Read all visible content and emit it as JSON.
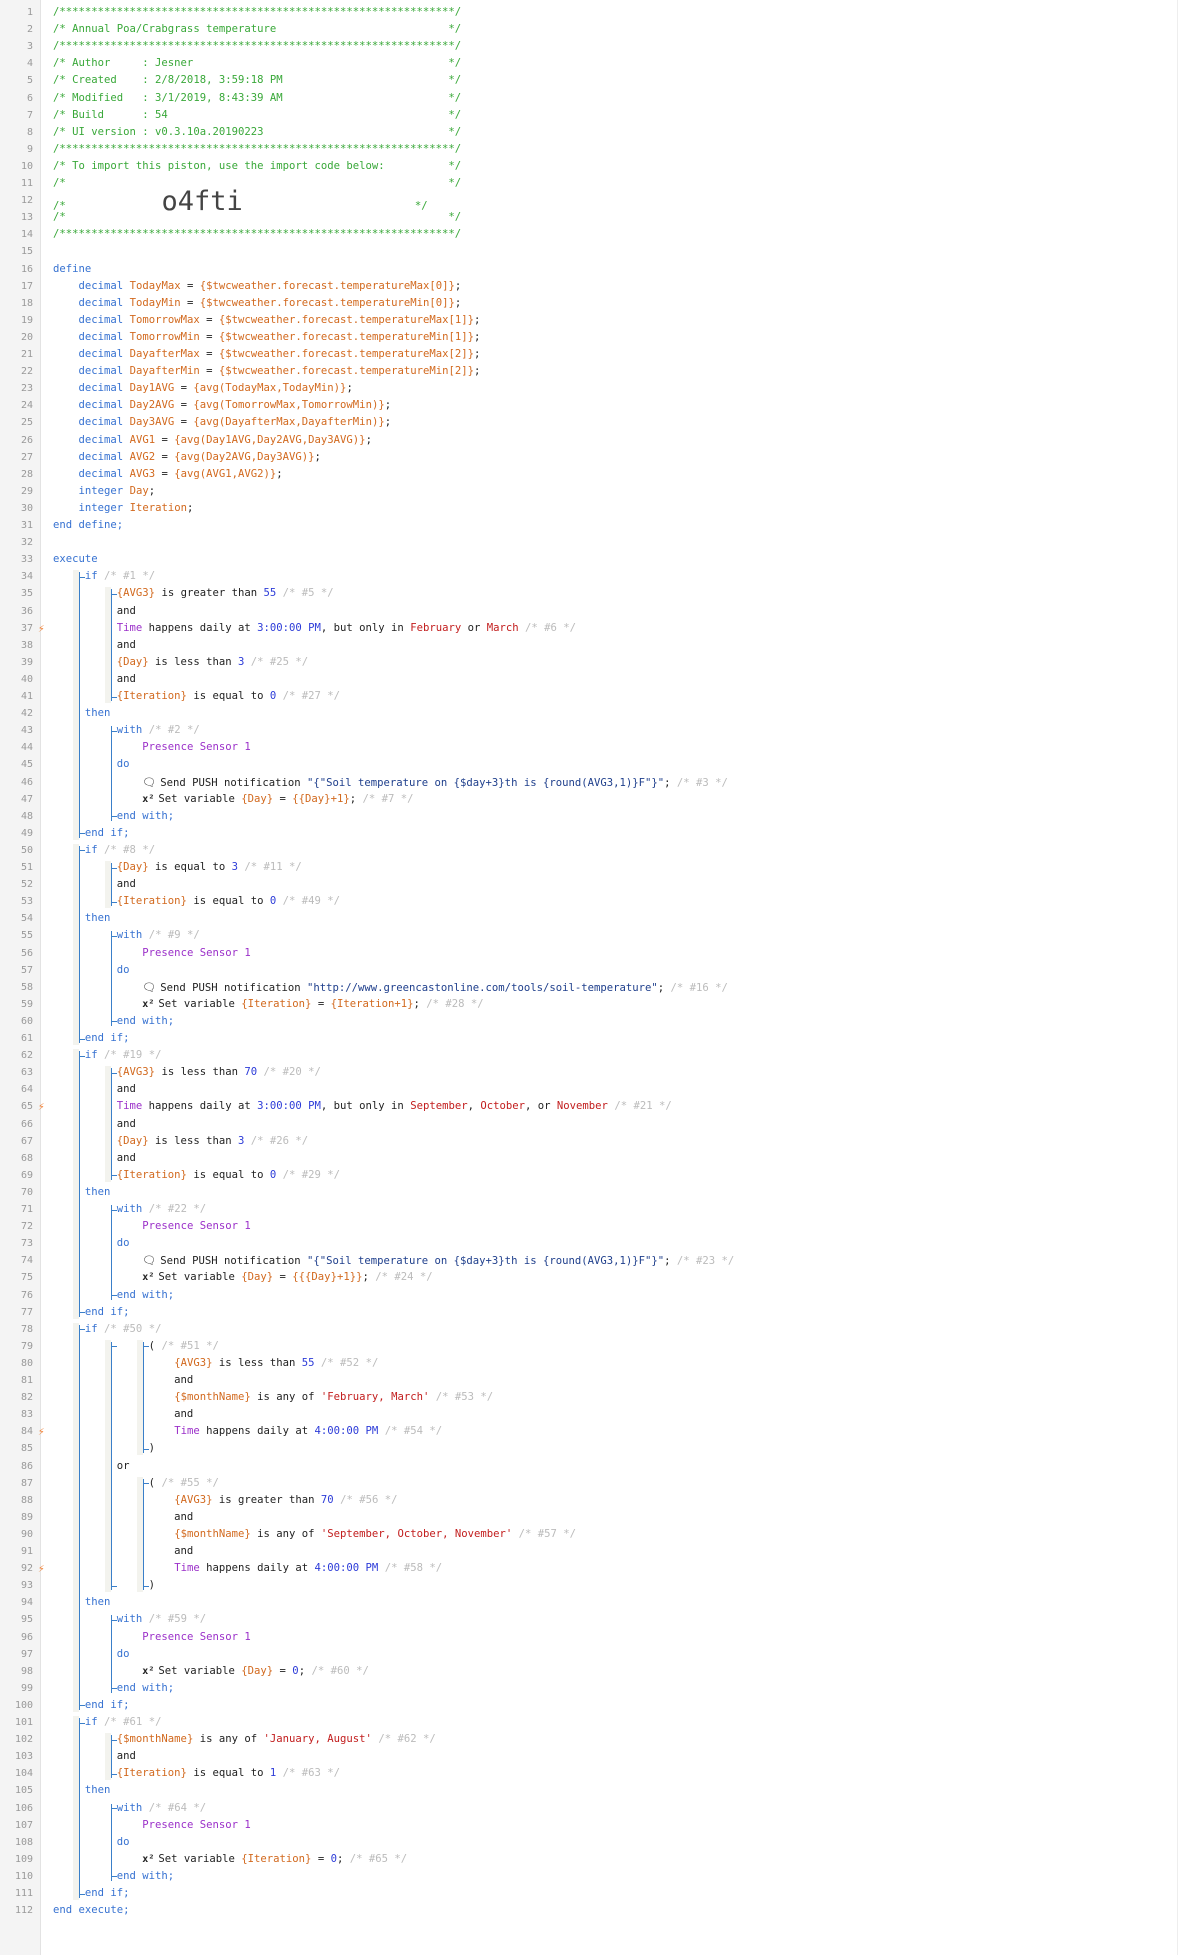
{
  "lines": [
    {
      "n": "1",
      "html": "<span class='c'>/**************************************************************/</span>"
    },
    {
      "n": "2",
      "html": "<span class='c'>/* Annual Poa/Crabgrass temperature                           */</span>"
    },
    {
      "n": "3",
      "html": "<span class='c'>/**************************************************************/</span>"
    },
    {
      "n": "4",
      "html": "<span class='c'>/* Author     : Jesner                                        */</span>"
    },
    {
      "n": "5",
      "html": "<span class='c'>/* Created    : 2/8/2018, 3:59:18 PM                          */</span>"
    },
    {
      "n": "6",
      "html": "<span class='c'>/* Modified   : 3/1/2019, 8:43:39 AM                          */</span>"
    },
    {
      "n": "7",
      "html": "<span class='c'>/* Build      : 54                                            */</span>"
    },
    {
      "n": "8",
      "html": "<span class='c'>/* UI version : v0.3.10a.20190223                             */</span>"
    },
    {
      "n": "9",
      "html": "<span class='c'>/**************************************************************/</span>"
    },
    {
      "n": "10",
      "html": "<span class='c'>/* To import this piston, use the import code below:          */</span>"
    },
    {
      "n": "11",
      "html": "<span class='c'>/*                                                            */</span>"
    },
    {
      "n": "12",
      "html": "<span class='c'>/*               <span class='big'>o4fti</span>                           */</span>"
    },
    {
      "n": "13",
      "html": "<span class='c'>/*                                                            */</span>"
    },
    {
      "n": "14",
      "html": "<span class='c'>/**************************************************************/</span>"
    },
    {
      "n": "15",
      "html": ""
    },
    {
      "n": "16",
      "html": "<span class='kw'>define</span>"
    },
    {
      "n": "17",
      "html": "    <span class='kw'>decimal</span> <span class='var'>TodayMax</span> = <span class='var'>{$twcweather.forecast.temperatureMax[0]}</span>;"
    },
    {
      "n": "18",
      "html": "    <span class='kw'>decimal</span> <span class='var'>TodayMin</span> = <span class='var'>{$twcweather.forecast.temperatureMin[0]}</span>;"
    },
    {
      "n": "19",
      "html": "    <span class='kw'>decimal</span> <span class='var'>TomorrowMax</span> = <span class='var'>{$twcweather.forecast.temperatureMax[1]}</span>;"
    },
    {
      "n": "20",
      "html": "    <span class='kw'>decimal</span> <span class='var'>TomorrowMin</span> = <span class='var'>{$twcweather.forecast.temperatureMin[1]}</span>;"
    },
    {
      "n": "21",
      "html": "    <span class='kw'>decimal</span> <span class='var'>DayafterMax</span> = <span class='var'>{$twcweather.forecast.temperatureMax[2]}</span>;"
    },
    {
      "n": "22",
      "html": "    <span class='kw'>decimal</span> <span class='var'>DayafterMin</span> = <span class='var'>{$twcweather.forecast.temperatureMin[2]}</span>;"
    },
    {
      "n": "23",
      "html": "    <span class='kw'>decimal</span> <span class='var'>Day1AVG</span> = <span class='var'>{avg(TodayMax,TodayMin)}</span>;"
    },
    {
      "n": "24",
      "html": "    <span class='kw'>decimal</span> <span class='var'>Day2AVG</span> = <span class='var'>{avg(TomorrowMax,TomorrowMin)}</span>;"
    },
    {
      "n": "25",
      "html": "    <span class='kw'>decimal</span> <span class='var'>Day3AVG</span> = <span class='var'>{avg(DayafterMax,DayafterMin)}</span>;"
    },
    {
      "n": "26",
      "html": "    <span class='kw'>decimal</span> <span class='var'>AVG1</span> = <span class='var'>{avg(Day1AVG,Day2AVG,Day3AVG)}</span>;"
    },
    {
      "n": "27",
      "html": "    <span class='kw'>decimal</span> <span class='var'>AVG2</span> = <span class='var'>{avg(Day2AVG,Day3AVG)}</span>;"
    },
    {
      "n": "28",
      "html": "    <span class='kw'>decimal</span> <span class='var'>AVG3</span> = <span class='var'>{avg(AVG1,AVG2)}</span>;"
    },
    {
      "n": "29",
      "html": "    <span class='kw'>integer</span> <span class='var'>Day</span>;"
    },
    {
      "n": "30",
      "html": "    <span class='kw'>integer</span> <span class='var'>Iteration</span>;"
    },
    {
      "n": "31",
      "html": "<span class='kw'>end define;</span>"
    },
    {
      "n": "32",
      "html": ""
    },
    {
      "n": "33",
      "html": "<span class='kw'>execute</span>"
    },
    {
      "n": "34",
      "html": "     <span class='kw'>if</span> <span class='cmt'>/* #1 */</span>"
    },
    {
      "n": "35",
      "html": "          <span class='var'>{AVG3}</span> is greater than <span class='num'>55</span> <span class='cmt'>/* #5 */</span>"
    },
    {
      "n": "36",
      "html": "          and"
    },
    {
      "n": "37",
      "bolt": true,
      "html": "          <span class='tk'>Time</span> happens daily at <span class='tm'>3:00:00 PM</span>, but only in <span class='mon'>February</span> or <span class='mon'>March</span> <span class='cmt'>/* #6 */</span>"
    },
    {
      "n": "38",
      "html": "          and"
    },
    {
      "n": "39",
      "html": "          <span class='var'>{Day}</span> is less than <span class='num'>3</span> <span class='cmt'>/* #25 */</span>"
    },
    {
      "n": "40",
      "html": "          and"
    },
    {
      "n": "41",
      "html": "          <span class='var'>{Iteration}</span> is equal to <span class='num'>0</span> <span class='cmt'>/* #27 */</span>"
    },
    {
      "n": "42",
      "html": "     <span class='kw'>then</span>"
    },
    {
      "n": "43",
      "html": "          <span class='kw'>with</span> <span class='cmt'>/* #2 */</span>"
    },
    {
      "n": "44",
      "html": "              <span class='dev'>Presence Sensor 1</span>"
    },
    {
      "n": "45",
      "html": "          <span class='kw'>do</span>"
    },
    {
      "n": "46",
      "html": "              <span class='icon'>&#x1F5E8;</span>Send PUSH notification <span class='strv'>\"{\"Soil temperature on {$day+3}th is {round(AVG3,1)}F\"}\"</span>; <span class='cmt'>/* #3 */</span>"
    },
    {
      "n": "47",
      "html": "              <span class='x2'>x&#178;</span>Set variable <span class='var'>{Day}</span> = <span class='var'>{{Day}+1}</span>; <span class='cmt'>/* #7 */</span>"
    },
    {
      "n": "48",
      "html": "          <span class='kw'>end with;</span>"
    },
    {
      "n": "49",
      "html": "     <span class='kw'>end if;</span>"
    },
    {
      "n": "50",
      "html": "     <span class='kw'>if</span> <span class='cmt'>/* #8 */</span>"
    },
    {
      "n": "51",
      "html": "          <span class='var'>{Day}</span> is equal to <span class='num'>3</span> <span class='cmt'>/* #11 */</span>"
    },
    {
      "n": "52",
      "html": "          and"
    },
    {
      "n": "53",
      "html": "          <span class='var'>{Iteration}</span> is equal to <span class='num'>0</span> <span class='cmt'>/* #49 */</span>"
    },
    {
      "n": "54",
      "html": "     <span class='kw'>then</span>"
    },
    {
      "n": "55",
      "html": "          <span class='kw'>with</span> <span class='cmt'>/* #9 */</span>"
    },
    {
      "n": "56",
      "html": "              <span class='dev'>Presence Sensor 1</span>"
    },
    {
      "n": "57",
      "html": "          <span class='kw'>do</span>"
    },
    {
      "n": "58",
      "html": "              <span class='icon'>&#x1F5E8;</span>Send PUSH notification <span class='strv'>\"http://www.greencastonline.com/tools/soil-temperature\"</span>; <span class='cmt'>/* #16 */</span>"
    },
    {
      "n": "59",
      "html": "              <span class='x2'>x&#178;</span>Set variable <span class='var'>{Iteration}</span> = <span class='var'>{Iteration+1}</span>; <span class='cmt'>/* #28 */</span>"
    },
    {
      "n": "60",
      "html": "          <span class='kw'>end with;</span>"
    },
    {
      "n": "61",
      "html": "     <span class='kw'>end if;</span>"
    },
    {
      "n": "62",
      "html": "     <span class='kw'>if</span> <span class='cmt'>/* #19 */</span>"
    },
    {
      "n": "63",
      "html": "          <span class='var'>{AVG3}</span> is less than <span class='num'>70</span> <span class='cmt'>/* #20 */</span>"
    },
    {
      "n": "64",
      "html": "          and"
    },
    {
      "n": "65",
      "bolt": true,
      "html": "          <span class='tk'>Time</span> happens daily at <span class='tm'>3:00:00 PM</span>, but only in <span class='mon'>September</span>, <span class='mon'>October</span>, or <span class='mon'>November</span> <span class='cmt'>/* #21 */</span>"
    },
    {
      "n": "66",
      "html": "          and"
    },
    {
      "n": "67",
      "html": "          <span class='var'>{Day}</span> is less than <span class='num'>3</span> <span class='cmt'>/* #26 */</span>"
    },
    {
      "n": "68",
      "html": "          and"
    },
    {
      "n": "69",
      "html": "          <span class='var'>{Iteration}</span> is equal to <span class='num'>0</span> <span class='cmt'>/* #29 */</span>"
    },
    {
      "n": "70",
      "html": "     <span class='kw'>then</span>"
    },
    {
      "n": "71",
      "html": "          <span class='kw'>with</span> <span class='cmt'>/* #22 */</span>"
    },
    {
      "n": "72",
      "html": "              <span class='dev'>Presence Sensor 1</span>"
    },
    {
      "n": "73",
      "html": "          <span class='kw'>do</span>"
    },
    {
      "n": "74",
      "html": "              <span class='icon'>&#x1F5E8;</span>Send PUSH notification <span class='strv'>\"{\"Soil temperature on {$day+3}th is {round(AVG3,1)}F\"}\"</span>; <span class='cmt'>/* #23 */</span>"
    },
    {
      "n": "75",
      "html": "              <span class='x2'>x&#178;</span>Set variable <span class='var'>{Day}</span> = <span class='var'>{{{Day}+1}}</span>; <span class='cmt'>/* #24 */</span>"
    },
    {
      "n": "76",
      "html": "          <span class='kw'>end with;</span>"
    },
    {
      "n": "77",
      "html": "     <span class='kw'>end if;</span>"
    },
    {
      "n": "78",
      "html": "     <span class='kw'>if</span> <span class='cmt'>/* #50 */</span>"
    },
    {
      "n": "79",
      "html": "               ( <span class='cmt'>/* #51 */</span>"
    },
    {
      "n": "80",
      "html": "                   <span class='var'>{AVG3}</span> is less than <span class='num'>55</span> <span class='cmt'>/* #52 */</span>"
    },
    {
      "n": "81",
      "html": "                   and"
    },
    {
      "n": "82",
      "html": "                   <span class='var'>{$monthName}</span> is any of <span class='mon'>'February, March'</span> <span class='cmt'>/* #53 */</span>"
    },
    {
      "n": "83",
      "html": "                   and"
    },
    {
      "n": "84",
      "bolt": true,
      "html": "                   <span class='tk'>Time</span> happens daily at <span class='tm'>4:00:00 PM</span> <span class='cmt'>/* #54 */</span>"
    },
    {
      "n": "85",
      "html": "               )"
    },
    {
      "n": "86",
      "html": "          or"
    },
    {
      "n": "87",
      "html": "               ( <span class='cmt'>/* #55 */</span>"
    },
    {
      "n": "88",
      "html": "                   <span class='var'>{AVG3}</span> is greater than <span class='num'>70</span> <span class='cmt'>/* #56 */</span>"
    },
    {
      "n": "89",
      "html": "                   and"
    },
    {
      "n": "90",
      "html": "                   <span class='var'>{$monthName}</span> is any of <span class='mon'>'September, October, November'</span> <span class='cmt'>/* #57 */</span>"
    },
    {
      "n": "91",
      "html": "                   and"
    },
    {
      "n": "92",
      "bolt": true,
      "html": "                   <span class='tk'>Time</span> happens daily at <span class='tm'>4:00:00 PM</span> <span class='cmt'>/* #58 */</span>"
    },
    {
      "n": "93",
      "html": "               )"
    },
    {
      "n": "94",
      "html": "     <span class='kw'>then</span>"
    },
    {
      "n": "95",
      "html": "          <span class='kw'>with</span> <span class='cmt'>/* #59 */</span>"
    },
    {
      "n": "96",
      "html": "              <span class='dev'>Presence Sensor 1</span>"
    },
    {
      "n": "97",
      "html": "          <span class='kw'>do</span>"
    },
    {
      "n": "98",
      "html": "              <span class='x2'>x&#178;</span>Set variable <span class='var'>{Day}</span> = <span class='num'>0</span>; <span class='cmt'>/* #60 */</span>"
    },
    {
      "n": "99",
      "html": "          <span class='kw'>end with;</span>"
    },
    {
      "n": "100",
      "html": "     <span class='kw'>end if;</span>"
    },
    {
      "n": "101",
      "html": "     <span class='kw'>if</span> <span class='cmt'>/* #61 */</span>"
    },
    {
      "n": "102",
      "html": "          <span class='var'>{$monthName}</span> is any of <span class='mon'>'January, August'</span> <span class='cmt'>/* #62 */</span>"
    },
    {
      "n": "103",
      "html": "          and"
    },
    {
      "n": "104",
      "html": "          <span class='var'>{Iteration}</span> is equal to <span class='num'>1</span> <span class='cmt'>/* #63 */</span>"
    },
    {
      "n": "105",
      "html": "     <span class='kw'>then</span>"
    },
    {
      "n": "106",
      "html": "          <span class='kw'>with</span> <span class='cmt'>/* #64 */</span>"
    },
    {
      "n": "107",
      "html": "              <span class='dev'>Presence Sensor 1</span>"
    },
    {
      "n": "108",
      "html": "          <span class='kw'>do</span>"
    },
    {
      "n": "109",
      "html": "              <span class='x2'>x&#178;</span>Set variable <span class='var'>{Iteration}</span> = <span class='num'>0</span>; <span class='cmt'>/* #65 */</span>"
    },
    {
      "n": "110",
      "html": "          <span class='kw'>end with;</span>"
    },
    {
      "n": "111",
      "html": "     <span class='kw'>end if;</span>"
    },
    {
      "n": "112",
      "html": "<span class='kw'>end execute;</span>"
    }
  ],
  "colors": {
    "comment": "#39a839",
    "keyword": "#3772d1",
    "variable": "#d2691e",
    "number": "#2c3bd8",
    "device": "#9b30c9",
    "month": "#c21d1d",
    "rail": "#3a7fc9",
    "bolt": "#f07f33"
  }
}
